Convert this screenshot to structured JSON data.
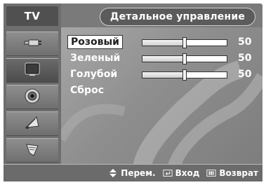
{
  "menu": {
    "tv_tab": "TV",
    "title": "Детальное управление"
  },
  "sidebar": {
    "items": [
      {
        "icon": "input-plug-icon"
      },
      {
        "icon": "picture-tv-icon"
      },
      {
        "icon": "speaker-sound-icon"
      },
      {
        "icon": "channel-satellite-icon"
      },
      {
        "icon": "setup-icon"
      }
    ]
  },
  "settings": {
    "items": [
      {
        "label": "Розовый",
        "value": "50",
        "level_percent": 50
      },
      {
        "label": "Зеленый",
        "value": "50",
        "level_percent": 50
      },
      {
        "label": "Голубой",
        "value": "50",
        "level_percent": 50
      },
      {
        "label": "Сброс"
      }
    ]
  },
  "footer": {
    "move": "Перем.",
    "enter": "Вход",
    "return": "Возврат"
  },
  "colors": {
    "panel": "#7a7a7a",
    "text": "#ffffff",
    "highlight": "#ffffff"
  }
}
